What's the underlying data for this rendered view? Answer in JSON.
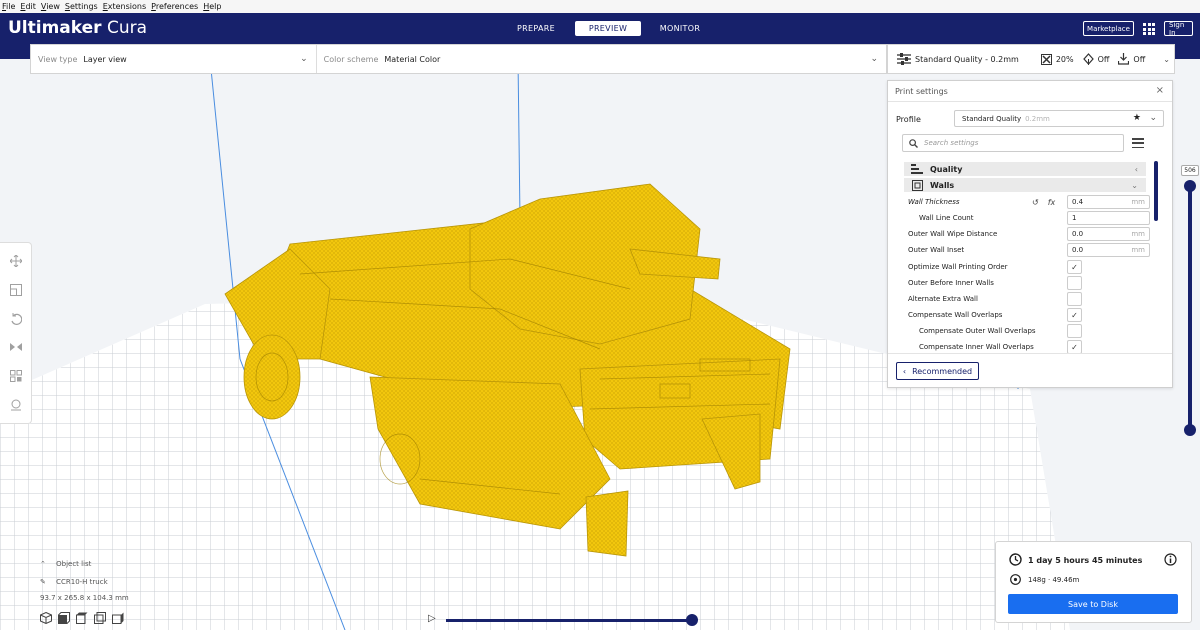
{
  "menubar": [
    "File",
    "Edit",
    "View",
    "Settings",
    "Extensions",
    "Preferences",
    "Help"
  ],
  "header": {
    "brand_bold": "Ultimaker",
    "brand_light": "Cura",
    "stages": [
      "PREPARE",
      "PREVIEW",
      "MONITOR"
    ],
    "active_stage": "PREVIEW",
    "marketplace": "Marketplace",
    "signin": "Sign In"
  },
  "viewbar": {
    "view_type_label": "View type",
    "view_type_value": "Layer view",
    "color_scheme_label": "Color scheme",
    "color_scheme_value": "Material Color"
  },
  "printbar": {
    "profile": "Standard Quality - 0.2mm",
    "infill": "20%",
    "support": "Off",
    "adhesion": "Off"
  },
  "panel": {
    "title": "Print settings",
    "profile_label": "Profile",
    "profile_name": "Standard Quality",
    "profile_suffix": "0.2mm",
    "search_placeholder": "Search settings",
    "categories": [
      "Quality",
      "Walls"
    ],
    "settings": [
      {
        "name": "Wall Thickness",
        "value": "0.4",
        "unit": "mm"
      },
      {
        "name": "Wall Line Count",
        "value": "1",
        "unit": ""
      },
      {
        "name": "Outer Wall Wipe Distance",
        "value": "0.0",
        "unit": "mm"
      },
      {
        "name": "Outer Wall Inset",
        "value": "0.0",
        "unit": "mm"
      },
      {
        "name": "Optimize Wall Printing Order",
        "checked": true
      },
      {
        "name": "Outer Before Inner Walls",
        "checked": false
      },
      {
        "name": "Alternate Extra Wall",
        "checked": false
      },
      {
        "name": "Compensate Wall Overlaps",
        "checked": true
      },
      {
        "name": "Compensate Outer Wall Overlaps",
        "checked": false
      },
      {
        "name": "Compensate Inner Wall Overlaps",
        "checked": true
      }
    ],
    "recommended": "Recommended"
  },
  "layer_slider": {
    "max_layer": "506"
  },
  "object_list": {
    "title": "Object list",
    "object_name": "CCR10-H truck",
    "dimensions": "93.7 x 265.8 x 104.3 mm"
  },
  "estimate": {
    "time": "1 day 5 hours 45 minutes",
    "material": "148g · 49.46m",
    "save": "Save to Disk"
  },
  "colors": {
    "header": "#17216b",
    "model": "#f2c70d",
    "save_button": "#196ef0",
    "build_plate": "#ffffff"
  }
}
